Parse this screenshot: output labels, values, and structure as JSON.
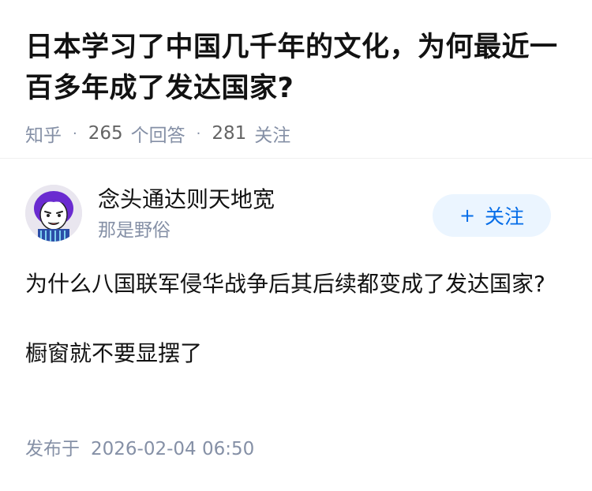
{
  "question": {
    "title": "日本学习了中国几千年的文化，为何最近一百多年成了发达国家?",
    "source": "知乎",
    "answer_count": "265",
    "answer_label": "个回答",
    "follower_count": "281",
    "follower_label": "关注"
  },
  "author": {
    "name": "念头通达则天地宽",
    "bio": "那是野俗",
    "follow_label": "关注",
    "follow_icon": "plus-icon"
  },
  "answer": {
    "paragraphs": [
      "为什么八国联军侵华战争后其后续都变成了发达国家?",
      "橱窗就不要显摆了"
    ]
  },
  "publish": {
    "label": "发布于",
    "time": "2026-02-04 06:50"
  },
  "colors": {
    "title": "#121212",
    "meta": "#8590a6",
    "accent": "#056de8",
    "follow_bg": "#ebf5ff"
  }
}
